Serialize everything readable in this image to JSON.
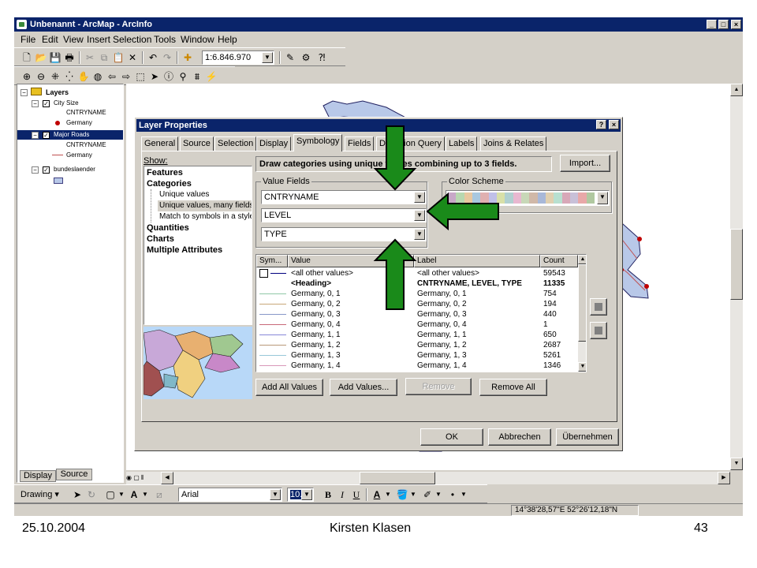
{
  "window": {
    "title": "Unbenannt - ArcMap - ArcInfo",
    "min": "_",
    "max": "□",
    "close": "×"
  },
  "menu": [
    "File",
    "Edit",
    "View",
    "Insert",
    "Selection",
    "Tools",
    "Window",
    "Help"
  ],
  "toolbar": {
    "scale": "1:6.846.970"
  },
  "toc": {
    "root": "Layers",
    "layers": [
      {
        "name": "City Size",
        "field": "CNTRYNAME",
        "value": "Germany"
      },
      {
        "name": "Major Roads",
        "field": "CNTRYNAME",
        "value": "Germany"
      },
      {
        "name": "bundeslaender"
      }
    ],
    "tabs": [
      "Display",
      "Source"
    ]
  },
  "dialog": {
    "title": "Layer Properties",
    "help": "?",
    "close": "×",
    "tabs": [
      "General",
      "Source",
      "Selection",
      "Display",
      "Symbology",
      "Fields",
      "Definition Query",
      "Labels",
      "Joins & Relates"
    ],
    "active_tab": "Symbology",
    "show_label": "Show:",
    "tree": [
      {
        "label": "Features",
        "bold": true,
        "indent": 0
      },
      {
        "label": "Categories",
        "bold": true,
        "indent": 0
      },
      {
        "label": "Unique values",
        "bold": false,
        "indent": 1
      },
      {
        "label": "Unique values, many fields",
        "bold": false,
        "indent": 1,
        "selected": true
      },
      {
        "label": "Match to symbols in a style",
        "bold": false,
        "indent": 1
      },
      {
        "label": "Quantities",
        "bold": true,
        "indent": 0
      },
      {
        "label": "Charts",
        "bold": true,
        "indent": 0
      },
      {
        "label": "Multiple Attributes",
        "bold": true,
        "indent": 0
      }
    ],
    "description": "Draw categories using unique values combining up to 3 fields.",
    "import_btn": "Import...",
    "value_fields_label": "Value Fields",
    "fields": [
      "CNTRYNAME",
      "LEVEL",
      "TYPE"
    ],
    "color_scheme_label": "Color Scheme",
    "color_scheme": [
      "#c8a8c8",
      "#b8d8b0",
      "#e8c8a0",
      "#a8c8e0",
      "#e0b0b0",
      "#c0c0e8",
      "#d8e0a8",
      "#b0d0d0",
      "#e8b8d0",
      "#c8d8b8",
      "#d0b8a8",
      "#a8b8d8",
      "#e0d0b0",
      "#b8e0d0",
      "#d8a8b8",
      "#c8c0d8",
      "#e8a8a8",
      "#b0c8a0"
    ],
    "table": {
      "headers": [
        "Sym...",
        "Value",
        "Label",
        "Count"
      ],
      "rows": [
        {
          "color": "#000080",
          "value": "<all other values>",
          "label": "<all other values>",
          "count": "59543",
          "bold": false,
          "box": true
        },
        {
          "color": "",
          "value": "<Heading>",
          "label": "CNTRYNAME, LEVEL, TYPE",
          "count": "11335",
          "bold": true
        },
        {
          "color": "#90c8a8",
          "value": "Germany, 0, 1",
          "label": "Germany, 0, 1",
          "count": "754"
        },
        {
          "color": "#c8a878",
          "value": "Germany, 0, 2",
          "label": "Germany, 0, 2",
          "count": "194"
        },
        {
          "color": "#8898c8",
          "value": "Germany, 0, 3",
          "label": "Germany, 0, 3",
          "count": "440"
        },
        {
          "color": "#c86878",
          "value": "Germany, 0, 4",
          "label": "Germany, 0, 4",
          "count": "1"
        },
        {
          "color": "#8888d8",
          "value": "Germany, 1, 1",
          "label": "Germany, 1, 1",
          "count": "650"
        },
        {
          "color": "#b89878",
          "value": "Germany, 1, 2",
          "label": "Germany, 1, 2",
          "count": "2687"
        },
        {
          "color": "#98c8d8",
          "value": "Germany, 1, 3",
          "label": "Germany, 1, 3",
          "count": "5261"
        },
        {
          "color": "#d898b8",
          "value": "Germany, 1, 4",
          "label": "Germany, 1, 4",
          "count": "1346"
        }
      ]
    },
    "buttons": {
      "add_all": "Add All Values",
      "add": "Add Values...",
      "remove": "Remove",
      "remove_all": "Remove All"
    },
    "footer": {
      "ok": "OK",
      "cancel": "Abbrechen",
      "apply": "Übernehmen"
    }
  },
  "drawing": {
    "label": "Drawing",
    "font": "Arial",
    "size": "10.0"
  },
  "status": {
    "coords": "14°38'28,57\"E  52°26'12,18\"N"
  },
  "slide_footer": {
    "date": "25.10.2004",
    "author": "Kirsten Klasen",
    "page": "43"
  },
  "colors": {
    "titlebar": "#0a246a",
    "face": "#d4d0c8",
    "arrow": "#1a8a1a"
  }
}
